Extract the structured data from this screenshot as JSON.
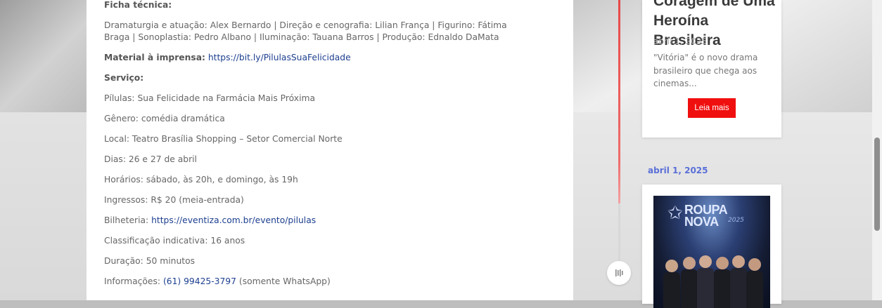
{
  "article": {
    "ficha_label": "Ficha técnica:",
    "ficha_text": "Dramaturgia e atuação: Alex Bernardo | Direção e cenografia: Lilian França | Figurino: Fátima Braga | Sonoplastia: Pedro Albano | Iluminação: Tauana Barros | Produção: Ednaldo DaMata",
    "material_label": "Material à imprensa:",
    "material_link": "https://bit.ly/PilulasSuaFelicidade",
    "servico_label": "Serviço:",
    "service_lines": [
      "Pílulas: Sua Felicidade na Farmácia Mais Próxima",
      "Gênero: comédia dramática",
      "Local: Teatro Brasília Shopping – Setor Comercial Norte",
      "Dias: 26 e 27 de abril",
      "Horários: sábado, às 20h, e domingo, às 19h",
      "Ingressos: R$ 20 (meia-entrada)"
    ],
    "bilheteria_label": "Bilheteria:",
    "bilheteria_link": "https://eventiza.com.br/evento/pilulas",
    "classificacao": "Classificação indicativa: 16 anos",
    "duracao": "Duração: 50 minutos",
    "info_label": "Informações:",
    "info_phone": "(61) 99425-3797",
    "info_suffix": "(somente WhatsApp)"
  },
  "sidebar": {
    "card1": {
      "title": "Coragem de Uma Heroína Brasileira",
      "date": "abril 1, 2025",
      "excerpt": "\"Vitória\" é o novo drama brasileiro que chega aos cinemas...",
      "button": "Leia mais"
    },
    "timeline_date": "abril 1, 2025",
    "card2": {
      "poster_brand_line1": "ROUPA",
      "poster_brand_line2": "NOVA",
      "poster_year": "2025"
    }
  },
  "colors": {
    "link": "#1d3f8f",
    "accent_red": "#f00f0f",
    "timeline_date": "#5a6fd8",
    "timeline_line": "#e74848"
  },
  "icons": {
    "timeline_icon": "media-icon"
  }
}
